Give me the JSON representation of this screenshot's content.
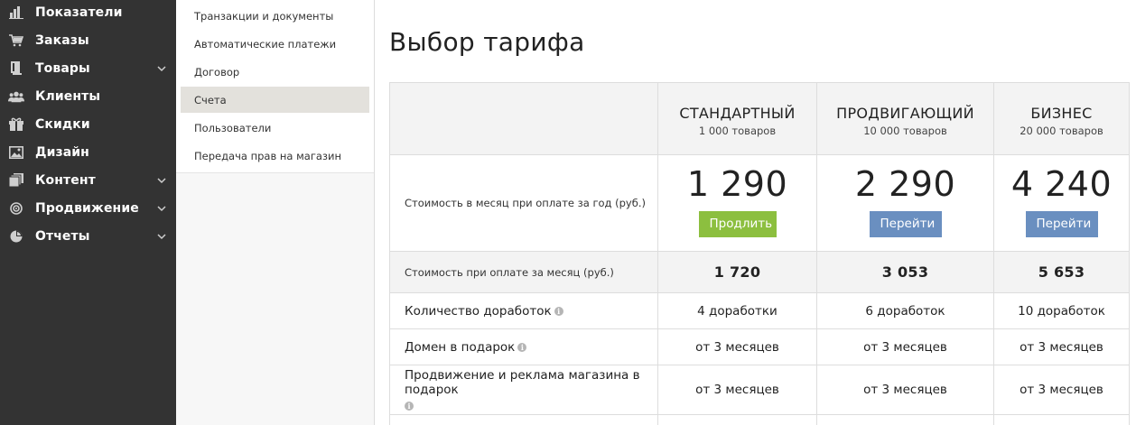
{
  "sidebar": {
    "items": [
      {
        "label": "Показатели",
        "icon": "bar-chart-icon",
        "has_submenu": false
      },
      {
        "label": "Заказы",
        "icon": "cart-icon",
        "has_submenu": false
      },
      {
        "label": "Товары",
        "icon": "book-icon",
        "has_submenu": true
      },
      {
        "label": "Клиенты",
        "icon": "users-icon",
        "has_submenu": false
      },
      {
        "label": "Скидки",
        "icon": "gift-icon",
        "has_submenu": false
      },
      {
        "label": "Дизайн",
        "icon": "image-icon",
        "has_submenu": false
      },
      {
        "label": "Контент",
        "icon": "pages-icon",
        "has_submenu": true
      },
      {
        "label": "Продвижение",
        "icon": "target-icon",
        "has_submenu": true
      },
      {
        "label": "Отчеты",
        "icon": "pie-chart-icon",
        "has_submenu": true
      }
    ]
  },
  "submenu": {
    "items": [
      {
        "label": "Транзакции и документы",
        "active": false
      },
      {
        "label": "Автоматические платежи",
        "active": false
      },
      {
        "label": "Договор",
        "active": false
      },
      {
        "label": "Счета",
        "active": true
      },
      {
        "label": "Пользователи",
        "active": false
      },
      {
        "label": "Передача прав на магазин",
        "active": false
      }
    ]
  },
  "page": {
    "title": "Выбор тарифа"
  },
  "plans": [
    {
      "name": "СТАНДАРТНЫЙ",
      "subtitle": "1 000 товаров",
      "price_year": "1 290",
      "button": "Продлить",
      "button_color": "#8cbf3f",
      "price_month": "1 720",
      "improvements": "4 доработки",
      "domain_gift": "от 3 месяцев",
      "promo_gift": "от 3 месяцев"
    },
    {
      "name": "ПРОДВИГАЮЩИЙ",
      "subtitle": "10 000 товаров",
      "price_year": "2 290",
      "button": "Перейти",
      "button_color": "#6a8fc0",
      "price_month": "3 053",
      "improvements": "6 доработок",
      "domain_gift": "от 3 месяцев",
      "promo_gift": "от 3 месяцев"
    },
    {
      "name": "БИЗНЕС",
      "subtitle": "20 000 товаров",
      "price_year": "4 240",
      "button": "Перейти",
      "button_color": "#6a8fc0",
      "price_month": "5 653",
      "improvements": "10 доработок",
      "domain_gift": "от 3 месяцев",
      "promo_gift": "от 3 месяцев"
    }
  ],
  "rows": {
    "price_year_label": "Стоимость в месяц при оплате за год (руб.)",
    "price_month_label": "Стоимость при оплате за месяц (руб.)",
    "improvements_label": "Количество доработок",
    "domain_label": "Домен в подарок",
    "promo_label": "Продвижение и реклама магазина в подарок",
    "info_icon": "i"
  },
  "colors": {
    "sidebar_bg": "#333333",
    "active_submenu_bg": "#e3e1dc",
    "header_row_bg": "#f3f3f3"
  }
}
